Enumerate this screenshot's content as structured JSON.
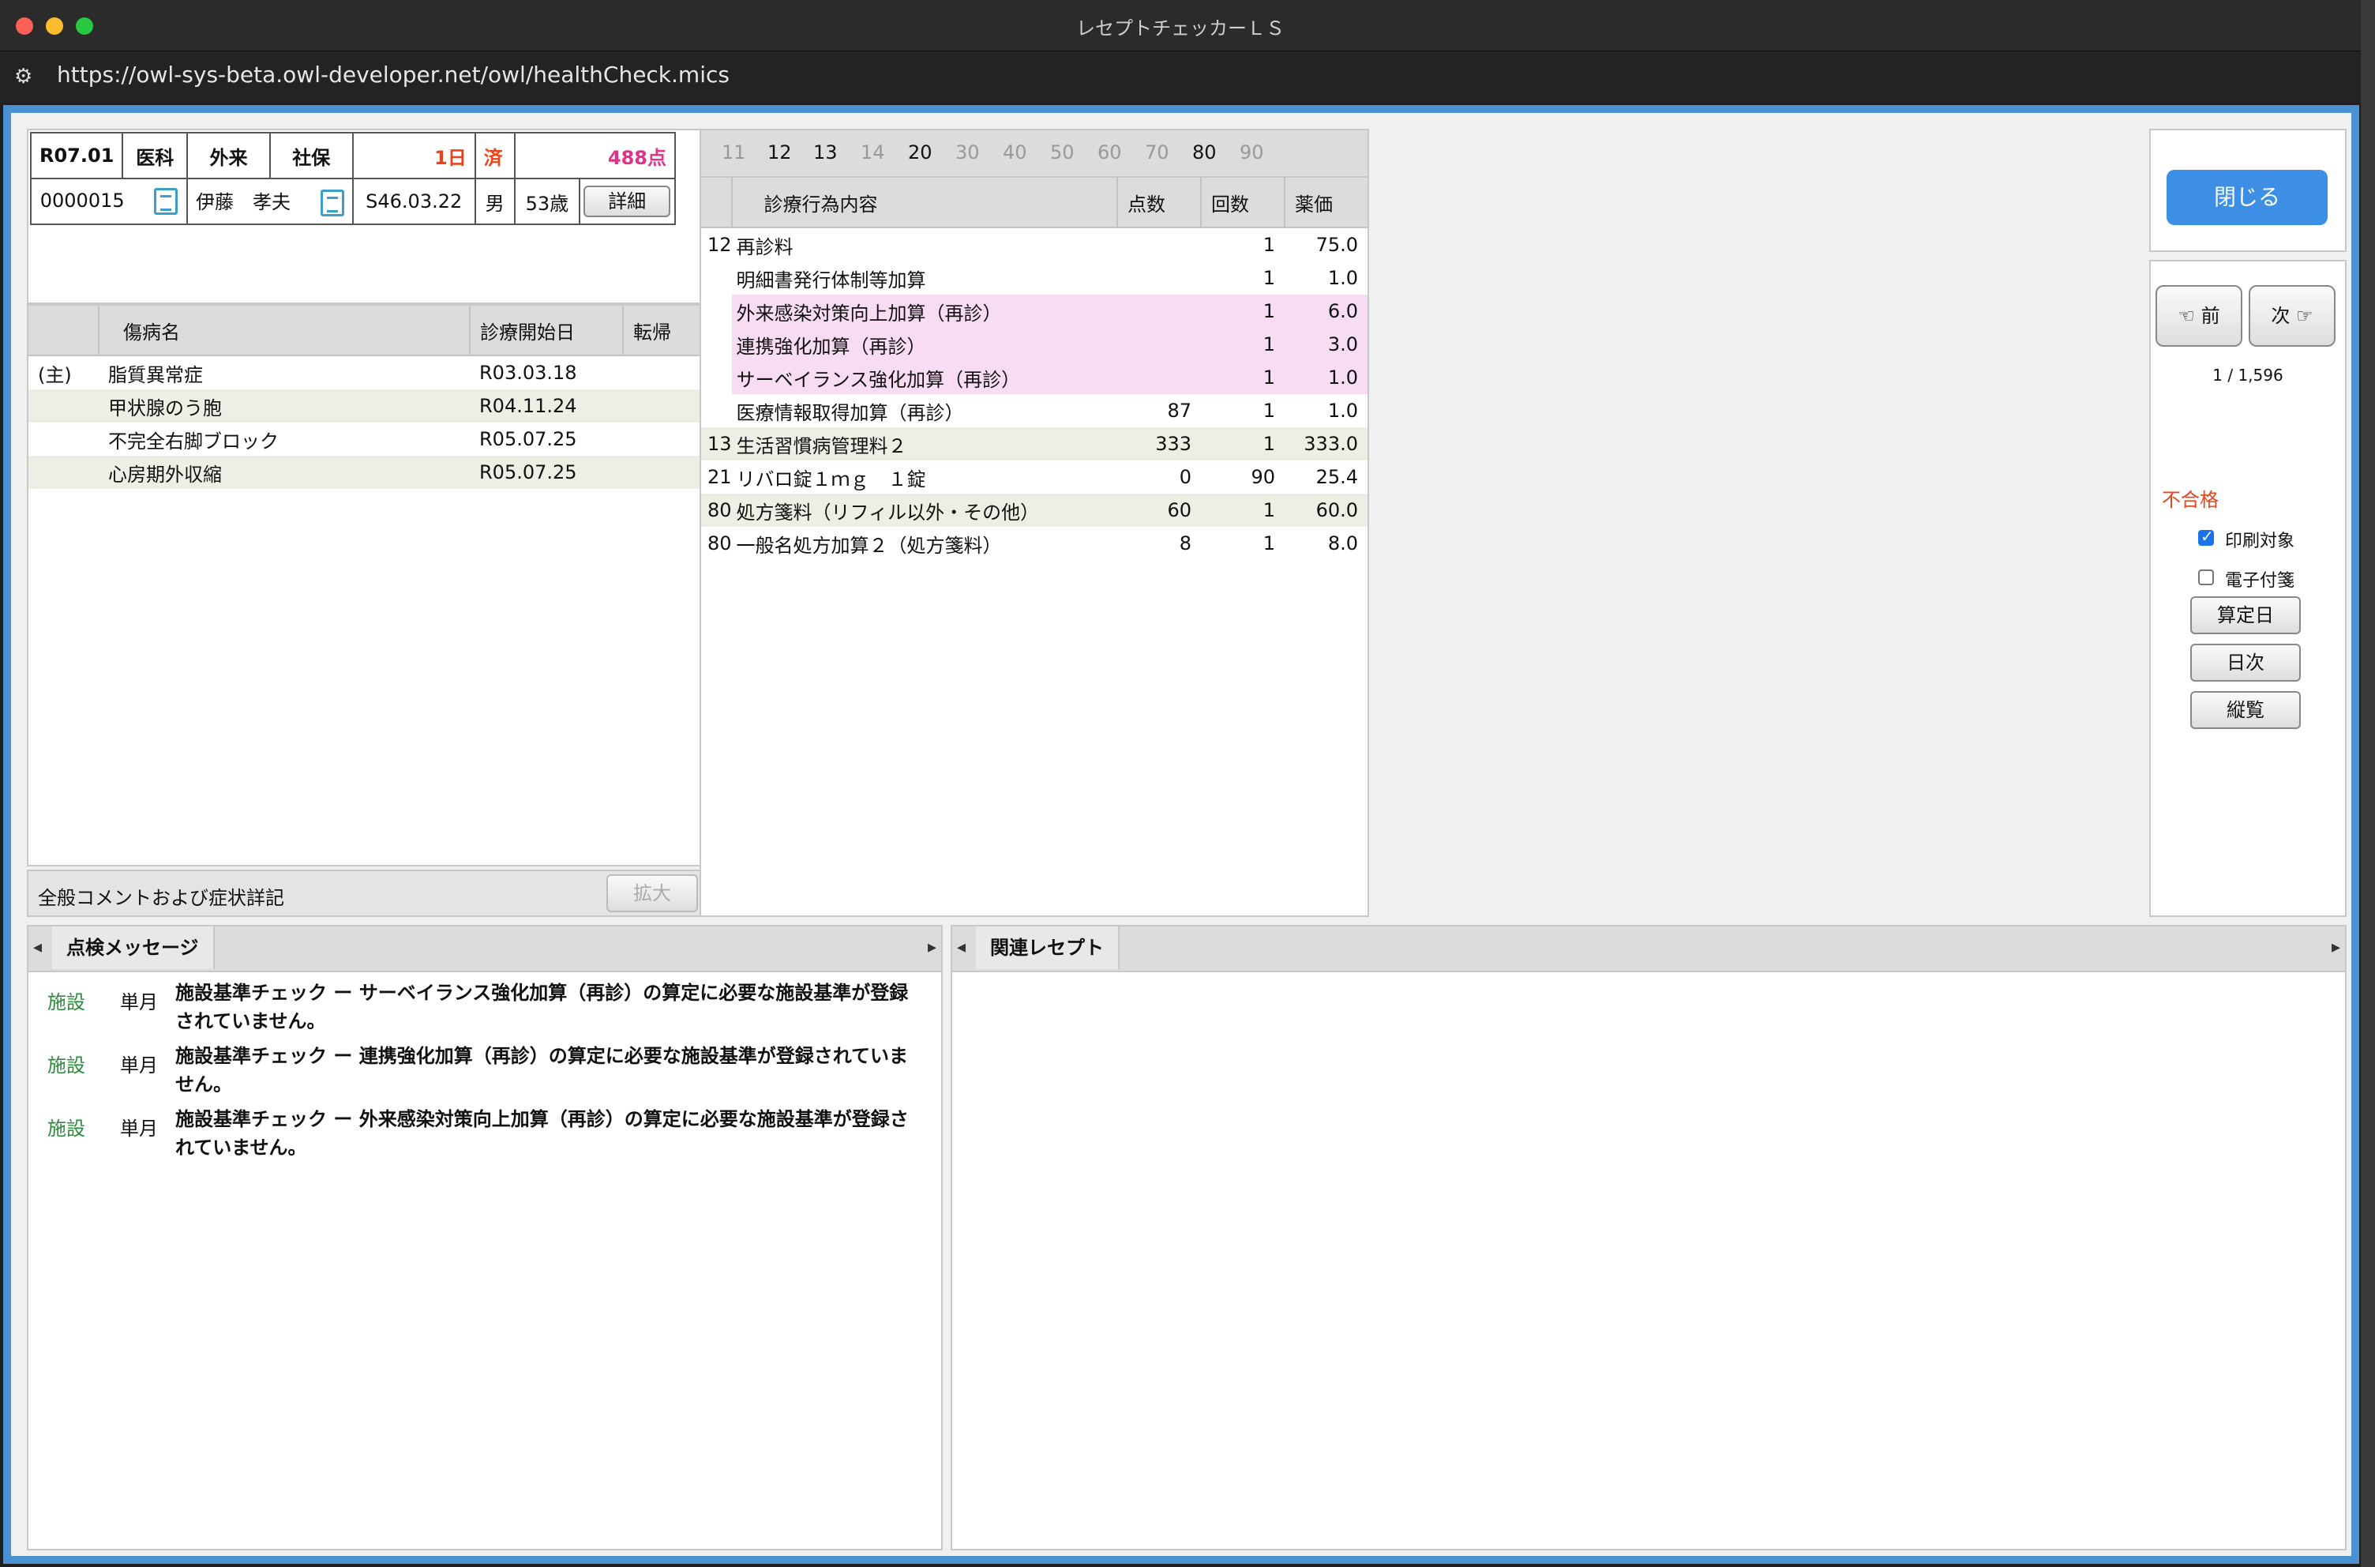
{
  "window": {
    "title": "レセプトチェッカーＬＳ",
    "url": "https://owl-sys-beta.owl-developer.net/owl/healthCheck.mics"
  },
  "header": {
    "row1": {
      "era_month": "R07.01",
      "dept": "医科",
      "type": "外来",
      "insurance": "社保",
      "days": "1日",
      "status": "済",
      "points": "488点"
    },
    "row2": {
      "patient_id": "0000015",
      "patient_name": "伊藤　孝夫",
      "birth": "S46.03.22",
      "sex": "男",
      "age": "53歳",
      "detail_button": "詳細"
    }
  },
  "disease_table": {
    "headers": {
      "name": "傷病名",
      "start": "診療開始日",
      "outcome": "転帰"
    },
    "rows": [
      {
        "flag": "(主)",
        "name": "脂質異常症",
        "start": "R03.03.18",
        "outcome": ""
      },
      {
        "flag": "",
        "name": "甲状腺のう胞",
        "start": "R04.11.24",
        "outcome": ""
      },
      {
        "flag": "",
        "name": "不完全右脚ブロック",
        "start": "R05.07.25",
        "outcome": ""
      },
      {
        "flag": "",
        "name": "心房期外収縮",
        "start": "R05.07.25",
        "outcome": ""
      }
    ]
  },
  "comment_bar": {
    "label": "全般コメントおよび症状詳記",
    "expand_button": "拡大"
  },
  "code_tabs": [
    "11",
    "12",
    "13",
    "14",
    "20",
    "30",
    "40",
    "50",
    "60",
    "70",
    "80",
    "90"
  ],
  "code_tabs_active": [
    "12",
    "13",
    "20",
    "80"
  ],
  "procedure_table": {
    "headers": {
      "content": "診療行為内容",
      "points": "点数",
      "count": "回数",
      "price": "薬価"
    },
    "rows": [
      {
        "code": "12",
        "content": "再診料",
        "points": "",
        "count": "1",
        "price": "75.0"
      },
      {
        "code": "",
        "content": "明細書発行体制等加算",
        "points": "",
        "count": "1",
        "price": "1.0"
      },
      {
        "code": "",
        "content": "外来感染対策向上加算（再診）",
        "points": "",
        "count": "1",
        "price": "6.0"
      },
      {
        "code": "",
        "content": "連携強化加算（再診）",
        "points": "",
        "count": "1",
        "price": "3.0"
      },
      {
        "code": "",
        "content": "サーベイランス強化加算（再診）",
        "points": "",
        "count": "1",
        "price": "1.0"
      },
      {
        "code": "",
        "content": "医療情報取得加算（再診）",
        "points": "87",
        "count": "1",
        "price": "1.0"
      },
      {
        "code": "13",
        "content": "生活習慣病管理料２",
        "points": "333",
        "count": "1",
        "price": "333.0"
      },
      {
        "code": "21",
        "content": "リバロ錠１ｍｇ　１錠",
        "points": "0",
        "count": "90",
        "price": "25.4"
      },
      {
        "code": "80",
        "content": "処方箋料（リフィル以外・その他）",
        "points": "60",
        "count": "1",
        "price": "60.0"
      },
      {
        "code": "80",
        "content": "一般名処方加算２（処方箋料）",
        "points": "8",
        "count": "1",
        "price": "8.0"
      }
    ]
  },
  "side": {
    "close_button": "閉じる",
    "prev_button": "☜ 前",
    "next_button": "次 ☞",
    "pager": "1 / 1,596",
    "result": "不合格",
    "print_target": "印刷対象",
    "print_checked": true,
    "e_attach": "電子付箋",
    "e_attach_checked": false,
    "calc_day_button": "算定日",
    "daily_button": "日次",
    "vertical_button": "縦覧"
  },
  "messages_panel": {
    "tab": "点検メッセージ",
    "items": [
      {
        "category": "施設",
        "period": "単月",
        "line1": "施設基準チェック ー サーベイランス強化加算（再診）の算定に必要な施設基準が登録",
        "line2": "されていません。"
      },
      {
        "category": "施設",
        "period": "単月",
        "line1": "施設基準チェック ー 連携強化加算（再診）の算定に必要な施設基準が登録されていま",
        "line2": "せん。"
      },
      {
        "category": "施設",
        "period": "単月",
        "line1": "施設基準チェック ー 外来感染対策向上加算（再診）の算定に必要な施設基準が登録さ",
        "line2": "れていません。"
      }
    ]
  },
  "related_panel": {
    "tab": "関連レセプト"
  },
  "colors": {
    "accent_blue": "#4a90d2",
    "close_button": "#3d8fe6",
    "fail_red": "#e8451c",
    "points_pink": "#e2308b",
    "category_green": "#2e8b3a",
    "highlight_pink": "#f7dcf4"
  }
}
